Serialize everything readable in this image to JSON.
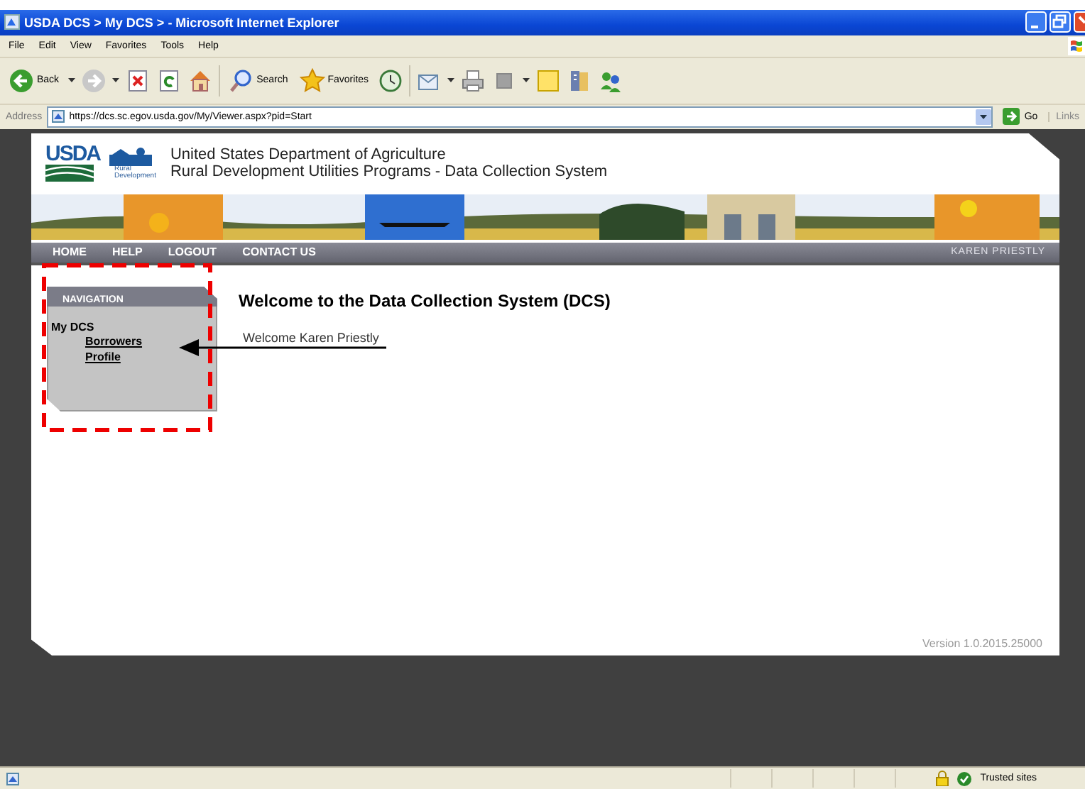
{
  "window": {
    "title": "USDA DCS > My DCS > - Microsoft Internet Explorer"
  },
  "menu": [
    "File",
    "Edit",
    "View",
    "Favorites",
    "Tools",
    "Help"
  ],
  "toolbar": [
    {
      "kind": "back",
      "label": "Back",
      "menu": true
    },
    {
      "kind": "forward",
      "menu": true
    },
    {
      "kind": "stop"
    },
    {
      "kind": "refresh"
    },
    {
      "kind": "home"
    },
    {
      "kind": "search",
      "label": "Search"
    },
    {
      "kind": "favorites",
      "label": "Favorites"
    },
    {
      "kind": "history"
    },
    {
      "kind": "mail",
      "menu": true
    },
    {
      "kind": "print"
    },
    {
      "kind": "edit",
      "menu": true
    },
    {
      "kind": "notes"
    },
    {
      "kind": "research"
    },
    {
      "kind": "messenger"
    }
  ],
  "address": {
    "label": "Address",
    "value": "https://dcs.sc.egov.usda.gov/My/Viewer.aspx?pid=Start",
    "go": "Go",
    "links": "Links"
  },
  "site": {
    "logo": "USDA",
    "sublogo": [
      "Rural",
      "Development"
    ],
    "title_lines": [
      "United States Department of Agriculture",
      "Rural Development Utilities Programs - Data Collection System"
    ],
    "nav": [
      "HOME",
      "HELP",
      "LOGOUT",
      "CONTACT US"
    ],
    "user": "KAREN PRIESTLY",
    "sidebar": {
      "heading": "NAVIGATION",
      "section": "My DCS",
      "links": [
        "Borrowers",
        "Profile"
      ]
    },
    "heading": "Welcome to the Data Collection System (DCS)",
    "welcome": "Welcome Karen Priestly",
    "version": "Version 1.0.2015.25000"
  },
  "status_bar": {
    "zone": "Trusted sites"
  }
}
